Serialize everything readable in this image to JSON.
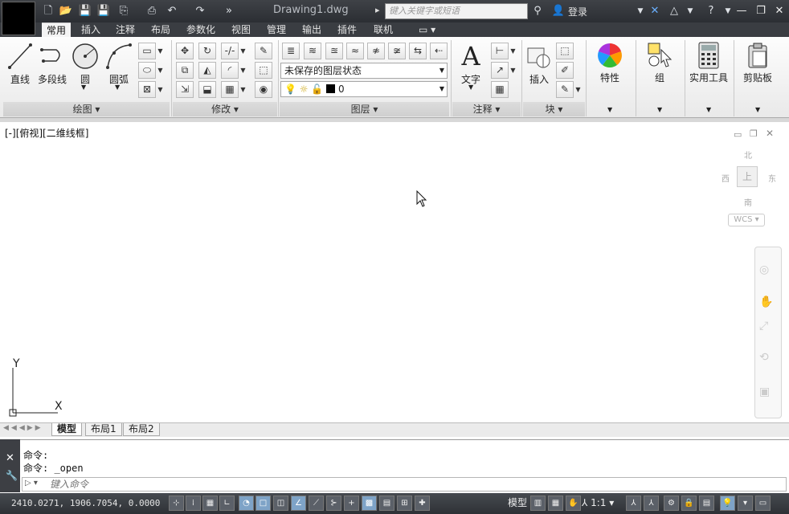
{
  "title_bar": {
    "document_title": "Drawing1.dwg",
    "search_placeholder": "键入关键字或短语",
    "login_label": "登录",
    "quick_access": [
      "new-icon",
      "open-icon",
      "save-icon",
      "save-as-icon",
      "publish-icon",
      "plot-icon",
      "undo-icon",
      "redo-icon"
    ],
    "window_controls": [
      "minimize-icon",
      "restore-icon",
      "close-icon"
    ]
  },
  "ribbon_tabs": [
    "常用",
    "插入",
    "注释",
    "布局",
    "参数化",
    "视图",
    "管理",
    "输出",
    "插件",
    "联机"
  ],
  "active_tab": "常用",
  "draw_panel": {
    "label": "绘图",
    "tools": [
      "直线",
      "多段线",
      "圆",
      "圆弧"
    ]
  },
  "modify_panel": {
    "label": "修改"
  },
  "layers_panel": {
    "label": "图层",
    "state_combo": "未保存的图层状态",
    "layer_combo": "0"
  },
  "annotation_panel": {
    "label": "注释",
    "text_tool": "文字"
  },
  "block_panel": {
    "label": "块",
    "insert_tool": "插入"
  },
  "large_tools": {
    "properties": "特性",
    "group": "组",
    "utilities": "实用工具",
    "clipboard": "剪贴板"
  },
  "viewport": {
    "label": "[-][俯视][二维线框]",
    "viewcube_face": "上",
    "compass": {
      "north": "北",
      "south": "南",
      "east": "东",
      "west": "西"
    },
    "wcs": "WCS",
    "ucs_x": "X",
    "ucs_y": "Y"
  },
  "layout_tabs": [
    "模型",
    "布局1",
    "布局2"
  ],
  "command_history": [
    "命令:",
    "命令: _open"
  ],
  "command_placeholder": "键入命令",
  "status_bar": {
    "coords": "2410.0271, 1906.7054, 0.0000",
    "model_label": "模型",
    "scale": "1:1"
  }
}
